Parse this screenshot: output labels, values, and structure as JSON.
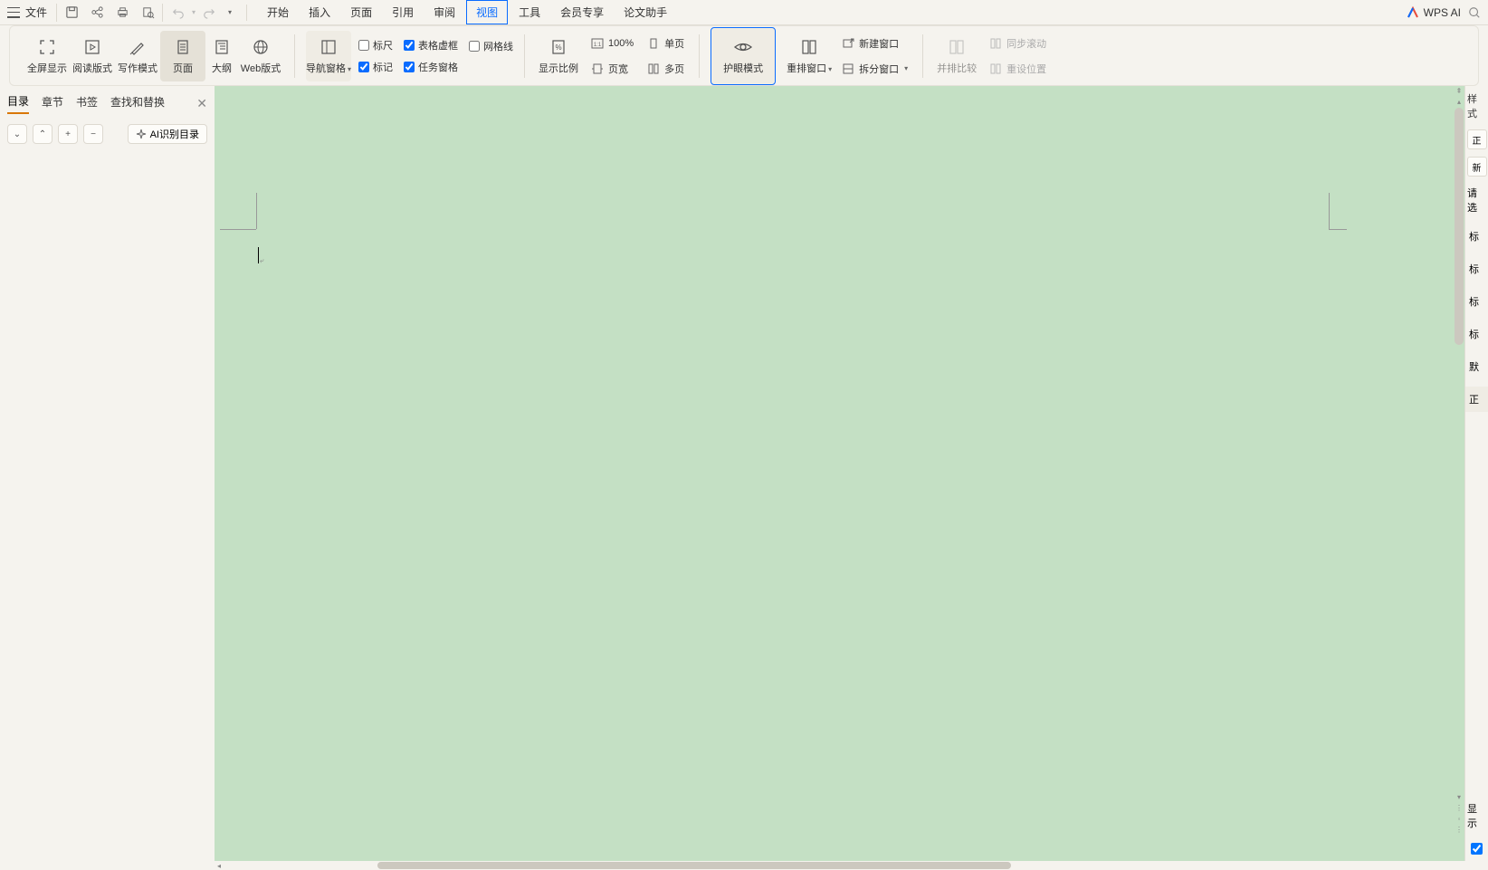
{
  "menubar": {
    "file": "文件",
    "tabs": [
      "开始",
      "插入",
      "页面",
      "引用",
      "审阅",
      "视图",
      "工具",
      "会员专享",
      "论文助手"
    ],
    "active_tab_index": 5,
    "wps_ai": "WPS AI"
  },
  "ribbon": {
    "view_modes": {
      "fullscreen": "全屏显示",
      "reading": "阅读版式",
      "writing": "写作模式",
      "page": "页面",
      "outline": "大纲",
      "web": "Web版式"
    },
    "nav_pane": "导航窗格",
    "checks_col1": {
      "ruler": "标尺",
      "marks": "标记"
    },
    "checks_col2": {
      "table_frame": "表格虚框",
      "task_pane": "任务窗格"
    },
    "checks_col3": {
      "gridlines": "网格线"
    },
    "zoom": {
      "display_ratio": "显示比例",
      "pct100": "100%",
      "page_width": "页宽",
      "single_page": "单页",
      "multi_page": "多页"
    },
    "eye_mode": "护眼模式",
    "arrange": "重排窗口",
    "new_window": "新建窗口",
    "split": "拆分窗口",
    "side_by_side": "并排比较",
    "sync_scroll": "同步滚动",
    "reset_pos": "重设位置"
  },
  "nav_panel": {
    "tabs": [
      "目录",
      "章节",
      "书签",
      "查找和替换"
    ],
    "active_index": 0,
    "ai_toc": "AI识别目录"
  },
  "styles_panel": {
    "header": "样式",
    "chip1": "正",
    "chip2": "新",
    "hint": "请选",
    "items": [
      "标",
      "标",
      "标",
      "标",
      "默",
      "正"
    ],
    "show": "显示"
  }
}
